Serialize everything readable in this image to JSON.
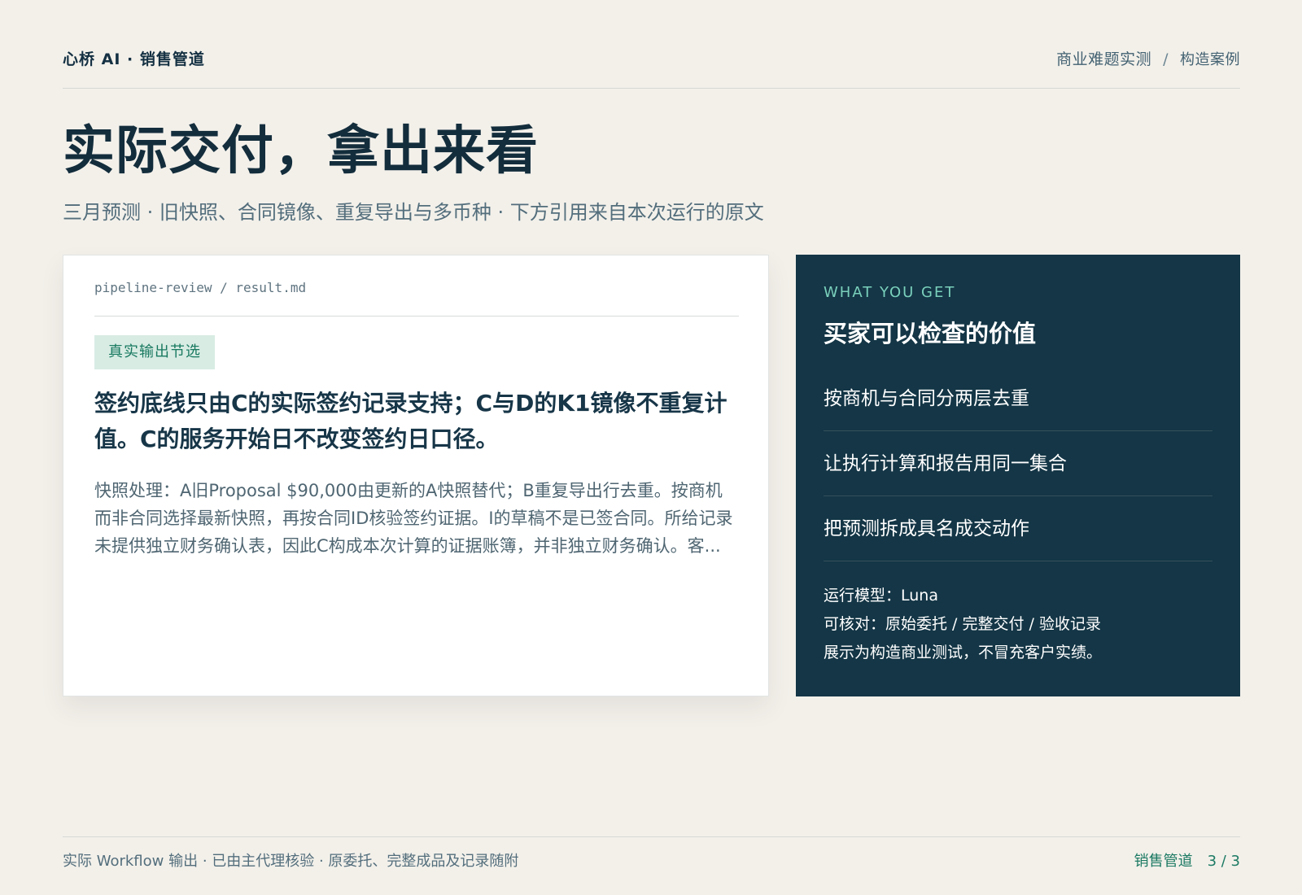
{
  "header": {
    "brand": "心桥 AI · 销售管道",
    "breadcrumb": {
      "section": "商业难题实测",
      "separator": "/",
      "current": "构造案例"
    }
  },
  "hero": {
    "title": "实际交付，拿出来看",
    "subtitle": "三月预测 · 旧快照、合同镜像、重复导出与多币种 · 下方引用来自本次运行的原文"
  },
  "result_card": {
    "file_path": "pipeline-review / result.md",
    "tag": "真实输出节选",
    "headline": "签约底线只由C的实际签约记录支持；C与D的K1镜像不重复计值。C的服务开始日不改变签约日口径。",
    "body": "快照处理：A旧Proposal $90,000由更新的A快照替代；B重复导出行去重。按商机而非合同选择最新快照，再按合同ID核验签约证据。I的草稿不是已签合同。所给记录未提供独立财务确认表，因此C构成本次计算的证据账簿，并非独立财务确认。客..."
  },
  "value_panel": {
    "eyebrow": "WHAT YOU GET",
    "title": "买家可以检查的价值",
    "items": [
      {
        "label": "按商机与合同分两层去重"
      },
      {
        "label": "让执行计算和报告用同一集合"
      },
      {
        "label": "把预测拆成具名成交动作"
      }
    ],
    "meta": {
      "model": "运行模型：Luna",
      "verification": "可核对：原始委托 / 完整交付 / 验收记录",
      "disclaimer": "展示为构造商业测试，不冒充客户实绩。"
    }
  },
  "footer": {
    "note": "实际 Workflow 输出 · 已由主代理核验 · 原委托、完整成品及记录随附",
    "section": "销售管道",
    "page": "3 / 3"
  },
  "colors": {
    "background": "#f3f0ea",
    "primary_text": "#143042",
    "panel": "#143646",
    "accent": "#1c7a63",
    "tag_background": "#d8ece4"
  }
}
